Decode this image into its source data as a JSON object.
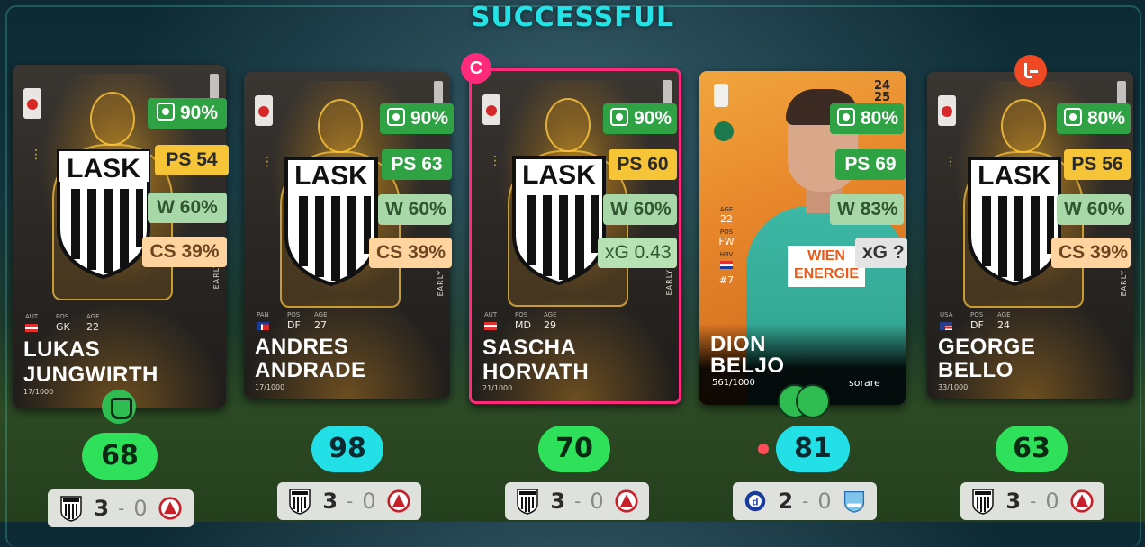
{
  "title": "SUCCESSFUL",
  "captain_label": "C",
  "cards": [
    {
      "player": "LUKAS\nJUNGWIRTH",
      "first": "LUKAS",
      "last": "JUNGWIRTH",
      "serial": "17/1000",
      "nat": "AUT",
      "pos": "GK",
      "age": "22",
      "meta_labels": {
        "nat": "AUT",
        "pos": "POS",
        "age": "AGE"
      },
      "stats": {
        "a": "90%",
        "b": "PS 54",
        "c": "W 60%",
        "d": "CS 39%"
      },
      "early": "EARLY",
      "score": "68",
      "result": {
        "home": "3",
        "away": "0"
      }
    },
    {
      "first": "ANDRES",
      "last": "ANDRADE",
      "serial": "17/1000",
      "nat": "PAN",
      "pos": "DF",
      "age": "27",
      "meta_labels": {
        "nat": "PAN",
        "pos": "POS",
        "age": "AGE"
      },
      "stats": {
        "a": "90%",
        "b": "PS 63",
        "c": "W 60%",
        "d": "CS 39%"
      },
      "early": "EARLY",
      "score": "98",
      "result": {
        "home": "3",
        "away": "0"
      }
    },
    {
      "first": "SASCHA",
      "last": "HORVATH",
      "serial": "21/1000",
      "nat": "AUT",
      "pos": "MD",
      "age": "29",
      "meta_labels": {
        "nat": "AUT",
        "pos": "POS",
        "age": "AGE"
      },
      "stats": {
        "a": "90%",
        "b": "PS 60",
        "c": "W 60%",
        "d": "xG 0.43"
      },
      "early": "EARLY",
      "score": "70",
      "result": {
        "home": "3",
        "away": "0"
      }
    },
    {
      "first": "DION",
      "last": "BELJO",
      "serial": "561/1000",
      "season": {
        "top": "24",
        "bottom": "25"
      },
      "side": {
        "age_label": "AGE",
        "age": "22",
        "pos_label": "POS",
        "pos": "FW",
        "nat": "HRV",
        "number": "#7"
      },
      "sponsor": {
        "line1": "WIEN",
        "line2": "ENERGIE"
      },
      "stats": {
        "a": "80%",
        "b": "PS 69",
        "c": "W 83%",
        "d": "xG ?"
      },
      "brand": "sorare",
      "score": "81",
      "result": {
        "home": "2",
        "away": "0"
      }
    },
    {
      "first": "GEORGE",
      "last": "BELLO",
      "serial": "33/1000",
      "nat": "USA",
      "pos": "DF",
      "age": "24",
      "meta_labels": {
        "nat": "USA",
        "pos": "POS",
        "age": "AGE"
      },
      "stats": {
        "a": "80%",
        "b": "PS 56",
        "c": "W 60%",
        "d": "CS 39%"
      },
      "early": "EARLY",
      "score": "63",
      "result": {
        "home": "3",
        "away": "0"
      }
    }
  ],
  "colors": {
    "accent": "#24e3e6",
    "captain": "#ff2a7a",
    "score_green": "#2ee05a",
    "score_cyan": "#22e0e6"
  },
  "icons": [
    "gloves-icon",
    "balls-icon",
    "substitution-icon",
    "captain-icon",
    "stat-icon"
  ]
}
